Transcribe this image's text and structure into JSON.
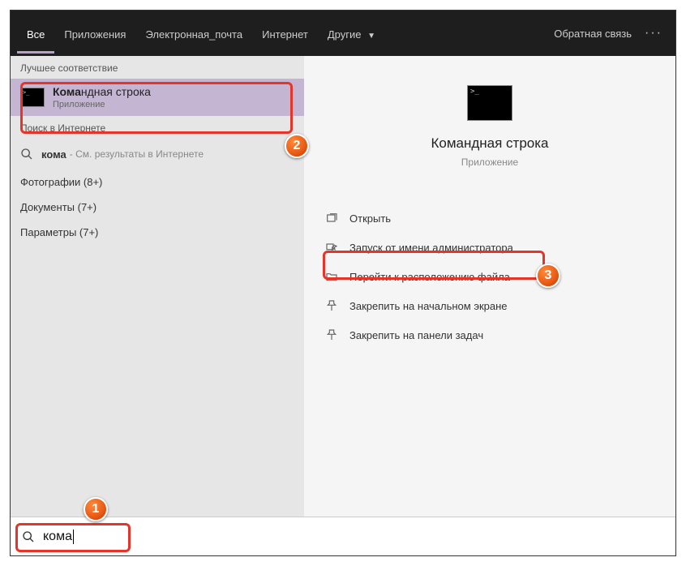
{
  "header": {
    "tabs": [
      {
        "label": "Все",
        "active": true
      },
      {
        "label": "Приложения"
      },
      {
        "label": "Электронная_почта"
      },
      {
        "label": "Интернет"
      },
      {
        "label": "Другие",
        "dropdown": true
      }
    ],
    "feedback": "Обратная связь"
  },
  "left": {
    "best_match_header": "Лучшее соответствие",
    "best_match": {
      "title_prefix": "Кома",
      "title_rest": "ндная строка",
      "subtitle": "Приложение"
    },
    "web_header": "Поиск в Интернете",
    "web": {
      "query": "кома",
      "hint": "- См. результаты в Интернете"
    },
    "categories": [
      "Фотографии (8+)",
      "Документы (7+)",
      "Параметры (7+)"
    ]
  },
  "right": {
    "title": "Командная строка",
    "subtitle": "Приложение",
    "actions": [
      "Открыть",
      "Запуск от имени администратора",
      "Перейти к расположению файла",
      "Закрепить на начальном экране",
      "Закрепить на панели задач"
    ]
  },
  "search": {
    "value": "кома"
  },
  "badges": {
    "b1": "1",
    "b2": "2",
    "b3": "3"
  }
}
